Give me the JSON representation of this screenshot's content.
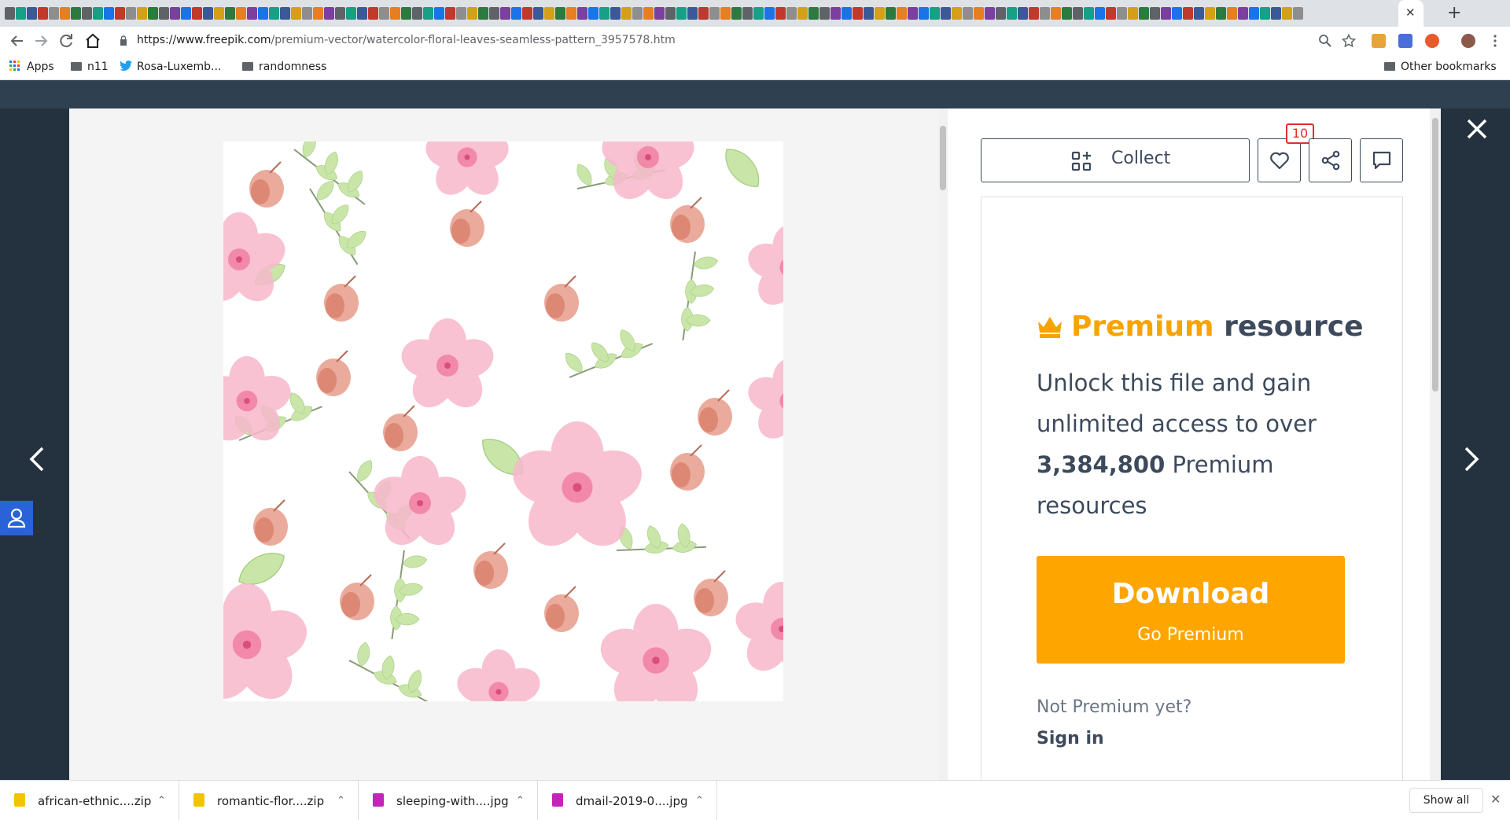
{
  "browser": {
    "tab_close_glyph": "✕",
    "new_tab_glyph": "+",
    "url_host": "https://www.freepik.com",
    "url_path": "/premium-vector/watercolor-floral-leaves-seamless-pattern_3957578.htm"
  },
  "bookmarks": {
    "apps_label": "Apps",
    "items": [
      "n11",
      "Rosa-Luxemb...",
      "randomness"
    ],
    "other_label": "Other bookmarks"
  },
  "panel": {
    "collect_label": "Collect",
    "like_count": "10",
    "premium_word": "Premium",
    "resource_word": "resource",
    "desc_before": "Unlock this file and gain unlimited access to over ",
    "resource_count": "3,384,800",
    "desc_after": " Premium resources",
    "download_label": "Download",
    "download_sub": "Go Premium",
    "not_premium": "Not Premium yet?",
    "sign_in": "Sign in"
  },
  "downloads": {
    "items": [
      {
        "name": "african-ethnic....zip",
        "icon_color": "#f2c400"
      },
      {
        "name": "romantic-flor....zip",
        "icon_color": "#f2c400"
      },
      {
        "name": "sleeping-with....jpg",
        "icon_color": "#c424b8"
      },
      {
        "name": "dmail-2019-0....jpg",
        "icon_color": "#c424b8"
      }
    ],
    "show_all": "Show all",
    "close_glyph": "✕",
    "caret_glyph": "⌃"
  },
  "colors": {
    "accent": "#ffa500",
    "premium": "#f7a300",
    "text": "#3d4a5c",
    "like_badge": "#e52e2e",
    "support": "#2a63d8"
  },
  "icons": [
    "back-icon",
    "forward-icon",
    "reload-icon",
    "home-icon",
    "lock-icon",
    "zoom-icon",
    "star-icon",
    "collect-icon",
    "heart-icon",
    "share-icon",
    "comment-icon",
    "crown-icon",
    "chevron-left-icon",
    "chevron-right-icon",
    "close-icon",
    "support-icon"
  ]
}
